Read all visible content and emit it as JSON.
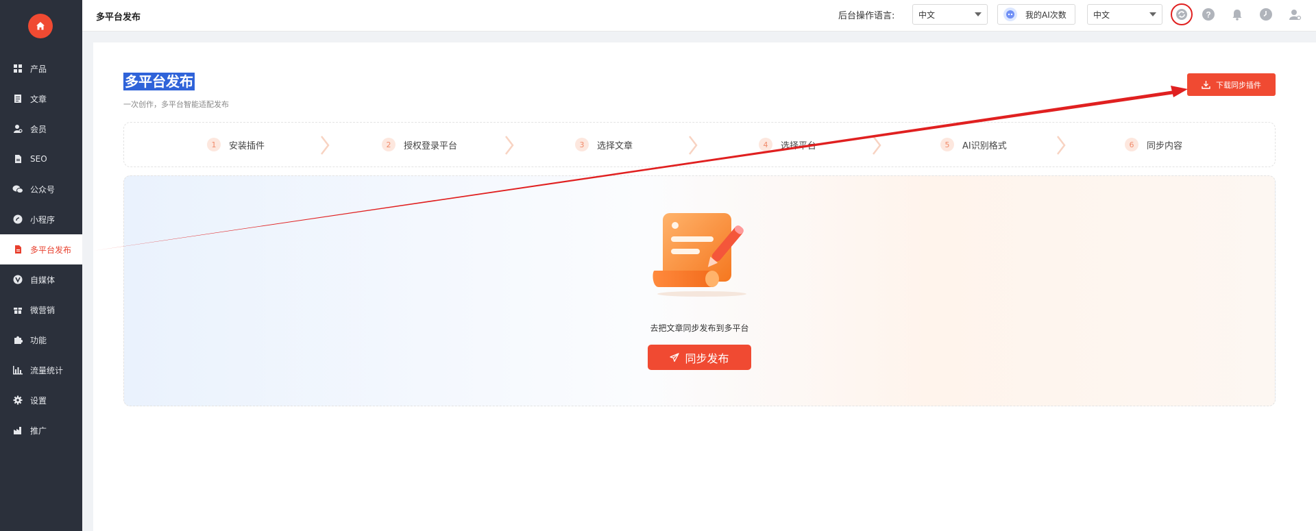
{
  "sidebar": {
    "logo_icon": "home-icon",
    "items": [
      {
        "label": "产品",
        "icon": "grid-icon"
      },
      {
        "label": "文章",
        "icon": "document-icon"
      },
      {
        "label": "会员",
        "icon": "user-settings-icon"
      },
      {
        "label": "SEO",
        "icon": "seo-file-icon"
      },
      {
        "label": "公众号",
        "icon": "wechat-icon"
      },
      {
        "label": "小程序",
        "icon": "mini-program-icon"
      },
      {
        "label": "多平台发布",
        "icon": "publish-file-icon",
        "active": true
      },
      {
        "label": "自媒体",
        "icon": "v-media-icon"
      },
      {
        "label": "微营销",
        "icon": "gift-icon"
      },
      {
        "label": "功能",
        "icon": "puzzle-icon"
      },
      {
        "label": "流量统计",
        "icon": "bar-chart-icon"
      },
      {
        "label": "设置",
        "icon": "gear-icon"
      },
      {
        "label": "推广",
        "icon": "factory-icon"
      }
    ]
  },
  "topbar": {
    "title": "多平台发布",
    "lang_label": "后台操作语言:",
    "lang_select_1": "中文",
    "ai_button": "我的AI次数",
    "lang_select_2": "中文"
  },
  "main": {
    "title": "多平台发布",
    "subtitle": "一次创作，多平台智能适配发布",
    "download_button": "下载同步插件",
    "steps": [
      {
        "num": "1",
        "label": "安装插件"
      },
      {
        "num": "2",
        "label": "授权登录平台"
      },
      {
        "num": "3",
        "label": "选择文章"
      },
      {
        "num": "4",
        "label": "选择平台"
      },
      {
        "num": "5",
        "label": "AI识别格式"
      },
      {
        "num": "6",
        "label": "同步内容"
      }
    ],
    "empty_text": "去把文章同步发布到多平台",
    "sync_button": "同步发布"
  },
  "colors": {
    "accent": "#f04a32",
    "sidebar_bg": "#2b303b",
    "highlight": "#2f63d9",
    "annotation_arrow": "#e02020"
  }
}
